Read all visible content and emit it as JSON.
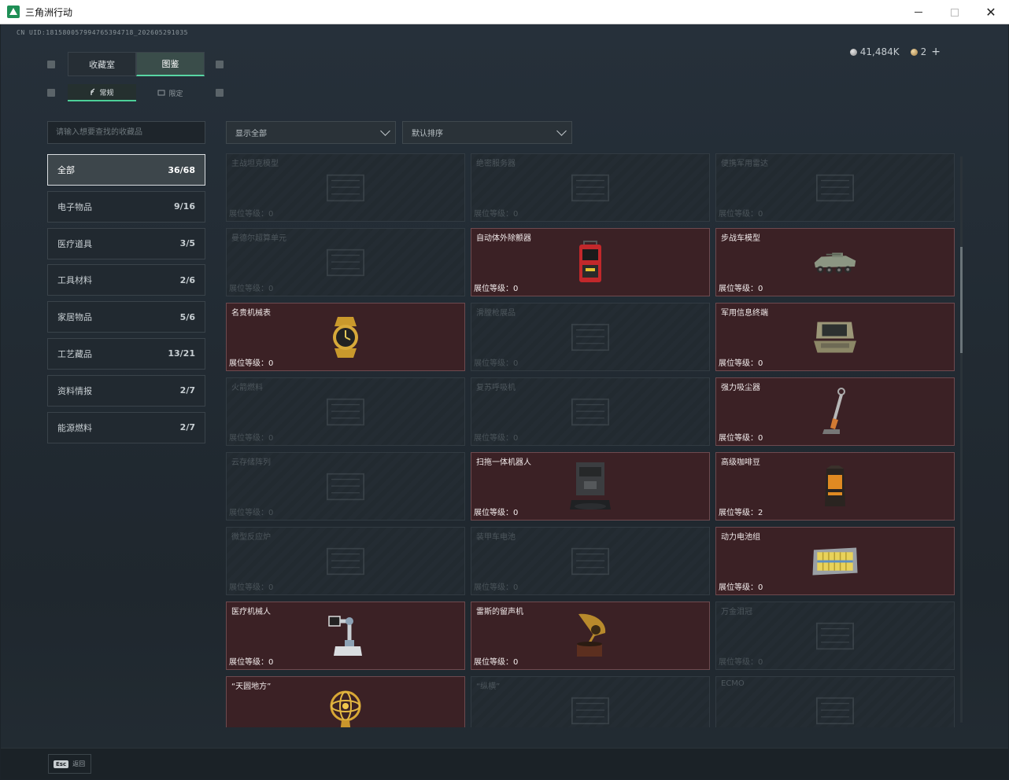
{
  "window": {
    "title": "三角洲行动"
  },
  "header": {
    "uid": "CN UID:181580057994765394718_202605291035"
  },
  "currency": {
    "silver": "41,484K",
    "gold": "2",
    "add_label": "+"
  },
  "main_tabs": [
    {
      "label": "收藏室"
    },
    {
      "label": "图鉴"
    }
  ],
  "sub_tabs": [
    {
      "label": "常规"
    },
    {
      "label": "限定"
    }
  ],
  "search": {
    "placeholder": "请输入想要查找的收藏品"
  },
  "filters": {
    "show": "显示全部",
    "sort": "默认排序"
  },
  "categories": [
    {
      "name": "全部",
      "count": "36/68"
    },
    {
      "name": "电子物品",
      "count": "9/16"
    },
    {
      "name": "医疗道具",
      "count": "3/5"
    },
    {
      "name": "工具材料",
      "count": "2/6"
    },
    {
      "name": "家居物品",
      "count": "5/6"
    },
    {
      "name": "工艺藏品",
      "count": "13/21"
    },
    {
      "name": "资料情报",
      "count": "2/7"
    },
    {
      "name": "能源燃料",
      "count": "2/7"
    }
  ],
  "items": [
    {
      "name": "主战坦克模型",
      "level": "展位等级：0",
      "owned": false,
      "icon": "tank-icon"
    },
    {
      "name": "绝密服务器",
      "level": "展位等级：0",
      "owned": false,
      "icon": "server-icon"
    },
    {
      "name": "便携军用雷达",
      "level": "展位等级：0",
      "owned": false,
      "icon": "radar-icon"
    },
    {
      "name": "曼德尔超算单元",
      "level": "展位等级：0",
      "owned": false,
      "icon": "computer-icon"
    },
    {
      "name": "自动体外除颤器",
      "level": "展位等级：0",
      "owned": true,
      "icon": "defibrillator-icon"
    },
    {
      "name": "步战车模型",
      "level": "展位等级：0",
      "owned": true,
      "icon": "ifv-icon"
    },
    {
      "name": "名贵机械表",
      "level": "展位等级：0",
      "owned": true,
      "icon": "watch-icon"
    },
    {
      "name": "滑膛枪展品",
      "level": "展位等级：0",
      "owned": false,
      "icon": "musket-icon"
    },
    {
      "name": "军用信息终端",
      "level": "展位等级：0",
      "owned": true,
      "icon": "terminal-icon"
    },
    {
      "name": "火箭燃料",
      "level": "展位等级：0",
      "owned": false,
      "icon": "fuel-icon"
    },
    {
      "name": "复苏呼吸机",
      "level": "展位等级：0",
      "owned": false,
      "icon": "ventilator-icon"
    },
    {
      "name": "强力吸尘器",
      "level": "展位等级：0",
      "owned": true,
      "icon": "vacuum-icon"
    },
    {
      "name": "云存储阵列",
      "level": "展位等级：0",
      "owned": false,
      "icon": "storage-icon"
    },
    {
      "name": "扫拖一体机器人",
      "level": "展位等级：0",
      "owned": true,
      "icon": "robot-icon"
    },
    {
      "name": "高级咖啡豆",
      "level": "展位等级：2",
      "owned": true,
      "icon": "coffee-icon"
    },
    {
      "name": "微型反应炉",
      "level": "展位等级：0",
      "owned": false,
      "icon": "reactor-icon"
    },
    {
      "name": "装甲车电池",
      "level": "展位等级：0",
      "owned": false,
      "icon": "battery-icon"
    },
    {
      "name": "动力电池组",
      "level": "展位等级：0",
      "owned": true,
      "icon": "battery-pack-icon"
    },
    {
      "name": "医疗机械人",
      "level": "展位等级：0",
      "owned": true,
      "icon": "medical-robot-icon"
    },
    {
      "name": "雷斯的留声机",
      "level": "展位等级：0",
      "owned": true,
      "icon": "gramophone-icon"
    },
    {
      "name": "万金泪冠",
      "level": "展位等级：0",
      "owned": false,
      "icon": "crown-icon"
    },
    {
      "name": "“天圆地方”",
      "level": "",
      "owned": true,
      "icon": "armillary-icon"
    },
    {
      "name": "“纵横”",
      "level": "",
      "owned": false,
      "icon": "board-icon"
    },
    {
      "name": "ECMO",
      "level": "",
      "owned": false,
      "icon": "ecmo-icon"
    }
  ],
  "footer": {
    "esc_key": "Esc",
    "back_label": "返回"
  }
}
